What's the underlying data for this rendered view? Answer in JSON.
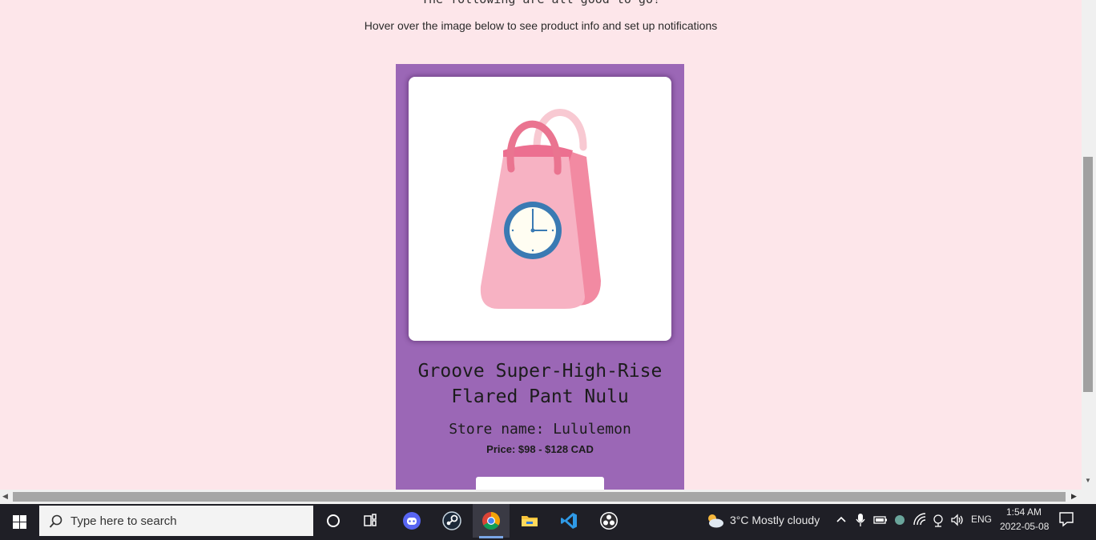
{
  "page": {
    "top_text": "The following are all good to go!",
    "instruction": "Hover over the image below to see product info and set up notifications"
  },
  "product": {
    "image_icon": "shopping-bag-with-clock",
    "title": "Groove Super-High-Rise Flared Pant Nulu",
    "store_name": "Store name: Lululemon",
    "price": "Price: $98 - $128 CAD",
    "card_color": "#9b67b6"
  },
  "taskbar": {
    "search_placeholder": "Type here to search",
    "apps": [
      "cortana-circle-icon",
      "task-view-icon",
      "discord-icon",
      "steam-icon",
      "chrome-icon",
      "file-explorer-icon",
      "vscode-icon",
      "obs-icon"
    ],
    "weather": "3°C  Mostly cloudy",
    "language": "ENG",
    "time": "1:54 AM",
    "date": "2022-05-08"
  },
  "colors": {
    "page_bg": "#fde6ea",
    "taskbar_bg": "#1f1f26",
    "accent": "#9b67b6"
  }
}
